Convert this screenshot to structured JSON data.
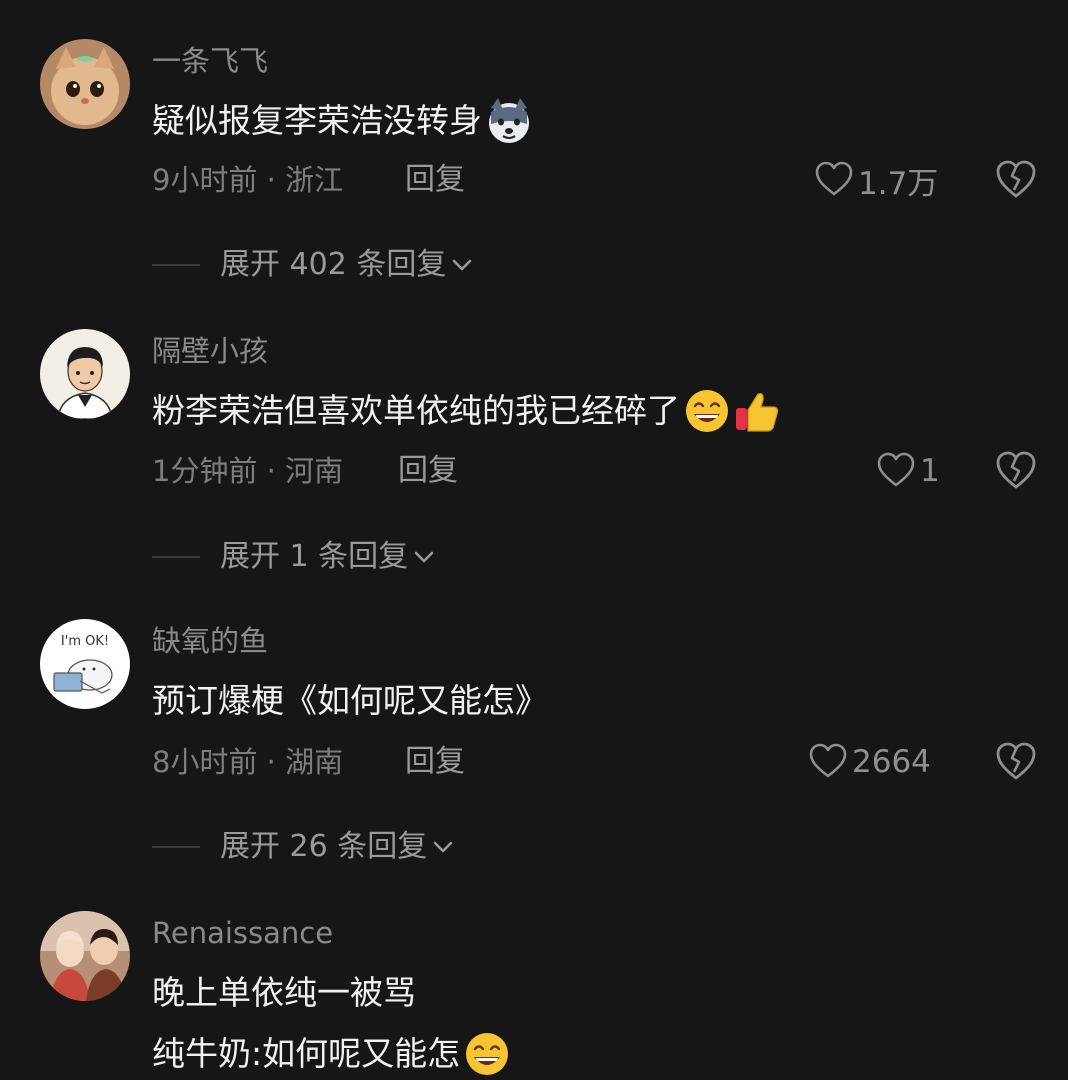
{
  "comments": [
    {
      "username": "一条飞飞",
      "lines": [
        "疑似报复李荣浩没转身"
      ],
      "meta": "9小时前 · 浙江",
      "reply_label": "回复",
      "likes": "1.7万",
      "expand_label": "展开 402 条回复"
    },
    {
      "username": "隔壁小孩",
      "lines": [
        "粉李荣浩但喜欢单依纯的我已经碎了"
      ],
      "meta": "1分钟前 · 河南",
      "reply_label": "回复",
      "likes": "1",
      "expand_label": "展开 1 条回复"
    },
    {
      "username": "缺氧的鱼",
      "lines": [
        "预订爆梗《如何呢又能怎》"
      ],
      "meta": "8小时前 · 湖南",
      "reply_label": "回复",
      "likes": "2664",
      "expand_label": "展开 26 条回复",
      "avatar_text": "I'm OK!"
    },
    {
      "username": "Renaissance",
      "lines": [
        "晚上单依纯一被骂",
        "纯牛奶:如何呢又能怎"
      ]
    }
  ],
  "icons": {
    "like": "heart-outline-icon",
    "dislike": "broken-heart-icon",
    "expand": "chevron-down-icon",
    "emoji_wolf": "wolf-face-emoji",
    "emoji_grin": "grinning-face-emoji",
    "emoji_thumb": "thumbs-up-emoji"
  },
  "colors": {
    "background": "#161616",
    "primary_text": "#f1f1f1",
    "secondary_text": "#8a8a8a"
  }
}
